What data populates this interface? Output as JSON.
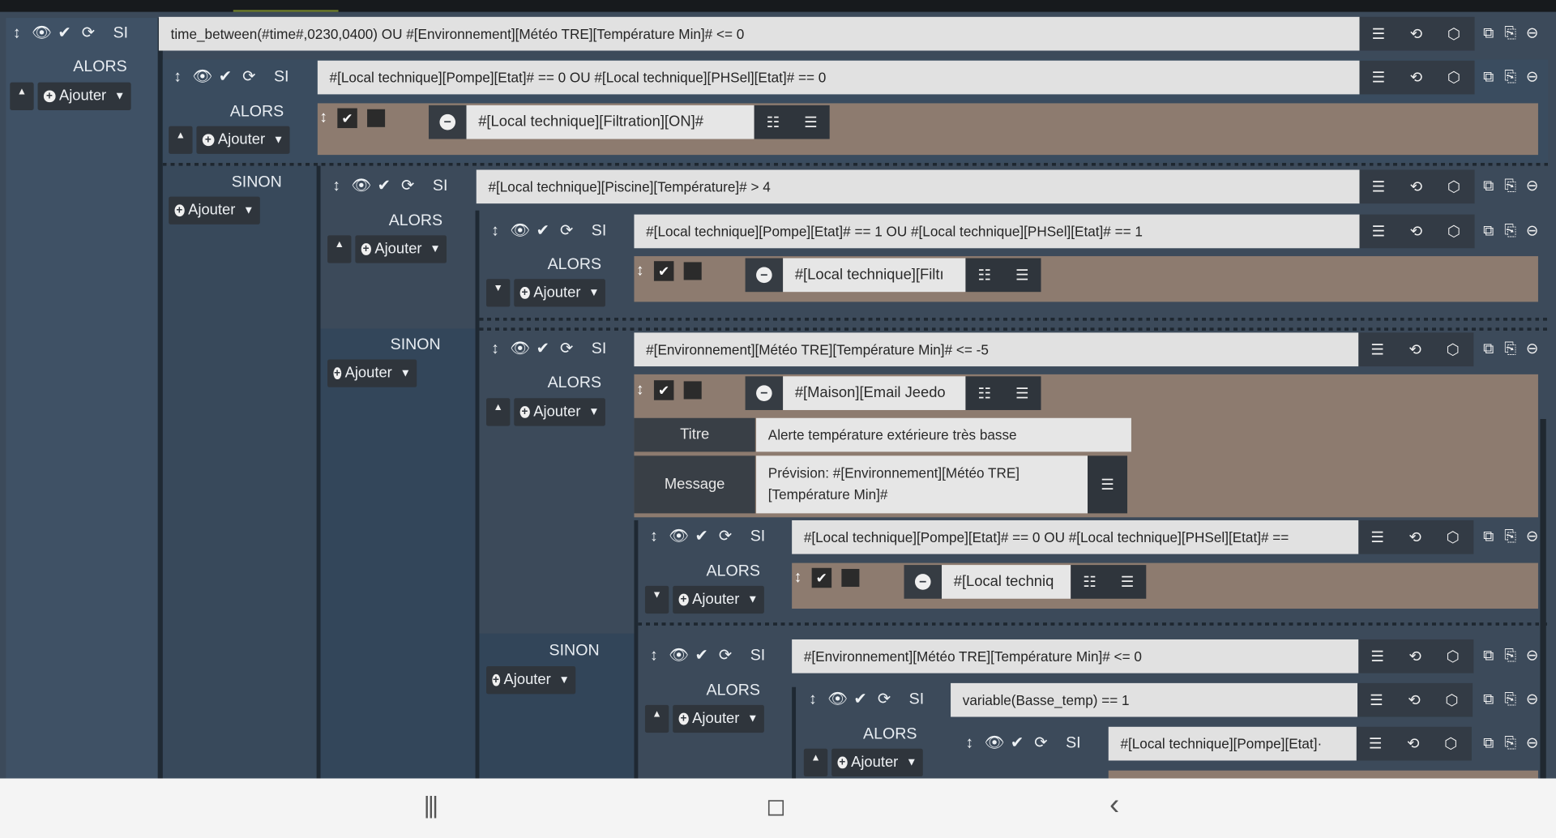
{
  "labels": {
    "si": "SI",
    "alors": "ALORS",
    "sinon": "SINON",
    "add": "Ajouter"
  },
  "conditions": {
    "c1": "time_between(#time#,0230,0400) OU  #[Environnement][Météo TRE][Température Min]# <= 0",
    "c2": "#[Local technique][Pompe][Etat]# == 0 OU #[Local technique][PHSel][Etat]# == 0",
    "c3": "#[Local technique][Piscine][Température]# > 4",
    "c4": "#[Local technique][Pompe][Etat]# == 1  OU #[Local technique][PHSel][Etat]# == 1",
    "c5": "#[Environnement][Météo TRE][Température Min]# <= -5",
    "c6": "#[Local technique][Pompe][Etat]# == 0  OU #[Local technique][PHSel][Etat]# ==",
    "c7": "#[Environnement][Météo TRE][Température Min]# <= 0",
    "c8": "variable(Basse_temp) == 1",
    "c9": "#[Local technique][Pompe][Etat]·"
  },
  "actions": {
    "a1": "#[Local technique][Filtration][ON]#",
    "a2": "#[Local technique][Filtı",
    "a3": "#[Maison][Email Jeedo",
    "a4": "#[Local techniq"
  },
  "email": {
    "title_label": "Titre",
    "title_value": "Alerte température extérieure très basse",
    "message_label": "Message",
    "message_value": "Prévision: #[Environnement][Météo TRE][Température Min]#"
  },
  "icons": {
    "move": "↕",
    "eye": "👁",
    "check": "✔",
    "refresh": "⟳",
    "list": "☰",
    "history": "⟲",
    "cube": "⬡",
    "copy": "⧉",
    "paste": "⎘",
    "remove": "⊖"
  },
  "nav": {
    "recent": "|||",
    "home": "◻",
    "back": "‹"
  }
}
